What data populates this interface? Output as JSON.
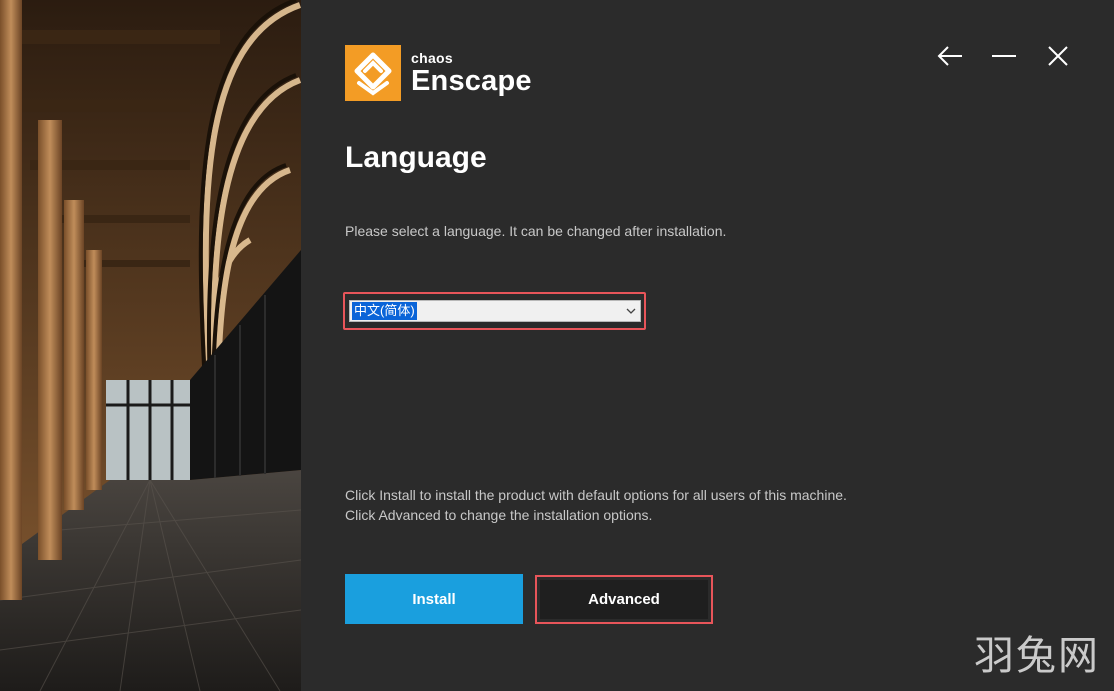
{
  "app": {
    "brand_small": "chaos",
    "brand_name": "Enscape"
  },
  "window_controls": {
    "back_icon": "arrow-left-icon",
    "minimize_icon": "minimize-icon",
    "close_icon": "close-icon"
  },
  "page": {
    "title": "Language",
    "subtitle": "Please select a language. It can be changed after installation."
  },
  "language_select": {
    "selected": "中文(简体)"
  },
  "info": {
    "line1": "Click Install to install the product with default options for all users of this machine.",
    "line2": "Click Advanced to change the installation options."
  },
  "buttons": {
    "install": "Install",
    "advanced": "Advanced"
  },
  "watermark": "羽兔网",
  "colors": {
    "accent_blue": "#1a9fde",
    "brand_orange": "#f39c25",
    "highlight_red": "#e8555a",
    "background": "#2b2b2b"
  }
}
